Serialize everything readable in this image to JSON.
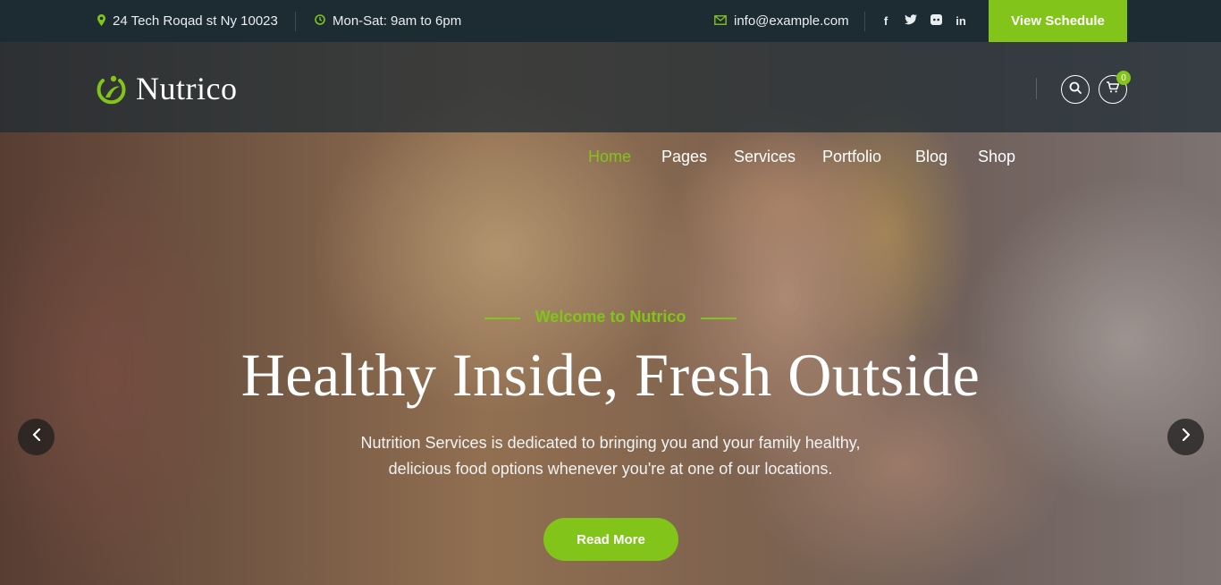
{
  "topbar": {
    "address": "24 Tech Roqad st Ny 10023",
    "hours": "Mon-Sat: 9am to 6pm",
    "email": "info@example.com",
    "social": [
      "f",
      "t",
      "d",
      "in"
    ],
    "schedule_label": "View Schedule"
  },
  "header": {
    "logo_text": "Nutrico",
    "nav": [
      "Home",
      "Pages",
      "Services",
      "Portfolio",
      "Blog",
      "Shop"
    ],
    "cart_count": "0"
  },
  "hero": {
    "eyebrow": "Welcome to Nutrico",
    "headline": "Healthy Inside, Fresh Outside",
    "description_line1": "Nutrition Services is dedicated to bringing you and your family healthy,",
    "description_line2": "delicious food options whenever you're at one of our locations.",
    "cta_label": "Read More"
  },
  "colors": {
    "accent": "#82c41a",
    "topbar_bg": "#1d2b33"
  }
}
